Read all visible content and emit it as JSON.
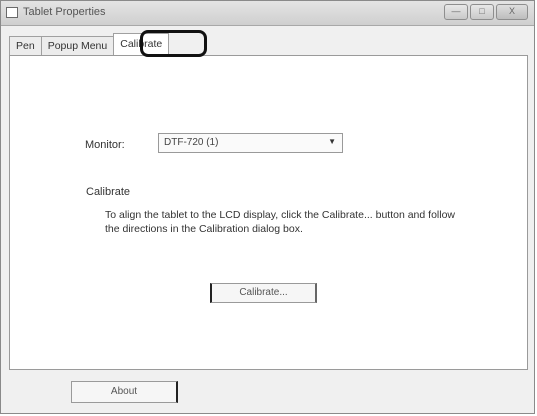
{
  "window": {
    "title": "Tablet Properties",
    "controls": {
      "minimize": "—",
      "maximize": "□",
      "close": "X"
    }
  },
  "tabs": [
    {
      "label": "Pen"
    },
    {
      "label": "Popup Menu"
    },
    {
      "label": "Calibrate",
      "active": true
    }
  ],
  "monitor": {
    "label": "Monitor:",
    "selected": "DTF-720 (1)"
  },
  "calibrate": {
    "heading": "Calibrate",
    "description": "To align the tablet to the LCD display, click the Calibrate... button and follow the directions in the Calibration dialog box.",
    "button_label": "Calibrate..."
  },
  "footer": {
    "about_label": "About"
  }
}
